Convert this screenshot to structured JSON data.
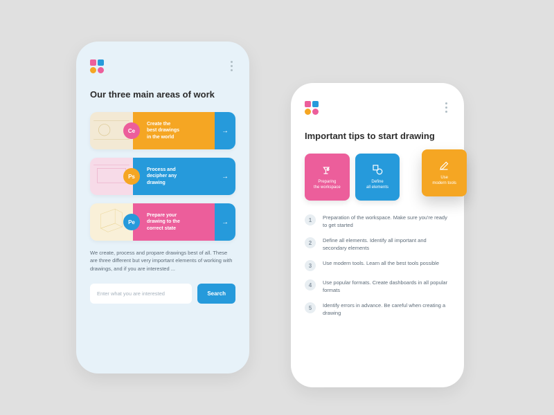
{
  "phone1": {
    "heading": "Our three main areas of work",
    "cards": [
      {
        "badge": "Ce",
        "title": "Create the\nbest drawings\nin the world",
        "badgeColor": "#ec5e9b",
        "bodyColor": "#f5a623",
        "imgBg": "#f3e9d4"
      },
      {
        "badge": "Ps",
        "title": "Process and\ndecipher any\ndrawing",
        "badgeColor": "#f5a623",
        "bodyColor": "#269adb",
        "imgBg": "#f7dbe8"
      },
      {
        "badge": "Pe",
        "title": "Prepare your\ndrawing to the\ncorrect state",
        "badgeColor": "#269adb",
        "bodyColor": "#ec5e9b",
        "imgBg": "#f9f0d8"
      }
    ],
    "description": "We create, process and propare drawings best of all. These are three different but very important elements of working with drawings, and if you are interested ...",
    "search": {
      "placeholder": "Enter what you are interested",
      "button": "Search"
    }
  },
  "phone2": {
    "heading": "Important tips to start drawing",
    "tips": [
      {
        "label": "Preparing\nthe workspace",
        "color": "#ec5e9b"
      },
      {
        "label": "Define\nall elements",
        "color": "#269adb"
      },
      {
        "label": "Use\nmodern tools",
        "color": "#f5a623"
      }
    ],
    "steps": [
      {
        "n": "1",
        "text": "Preparation of the workspace. Make sure you're ready to get started"
      },
      {
        "n": "2",
        "text": "Define all elements. Identify all important and secondary elements"
      },
      {
        "n": "3",
        "text": "Use modern tools. Learn all the best tools possible"
      },
      {
        "n": "4",
        "text": "Use popular formats. Create dashboards in all popular formats"
      },
      {
        "n": "5",
        "text": "Identify errors in advance. Be careful when creating a drawing"
      }
    ]
  }
}
